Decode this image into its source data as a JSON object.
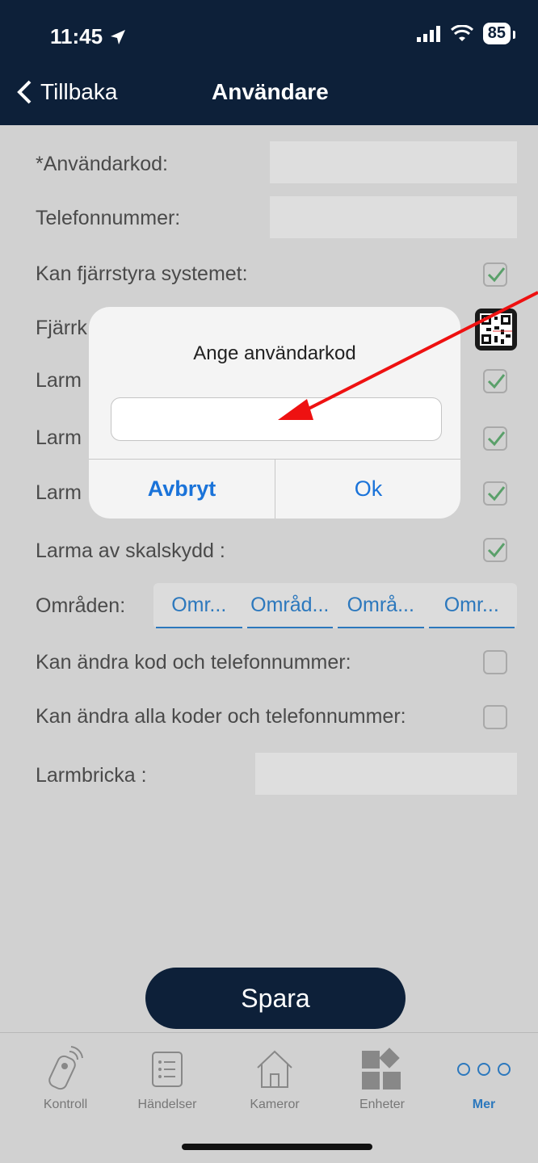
{
  "status_bar": {
    "time": "11:45",
    "battery": "85"
  },
  "nav": {
    "back_label": "Tillbaka",
    "title": "Användare"
  },
  "form": {
    "user_code_label": "*Användarkod:",
    "phone_label": "Telefonnummer:",
    "remote_control_label": "Kan fjärrstyra systemet:",
    "remote_control_checked": true,
    "remote_key_label_partial": "Fjärrk",
    "arm1_label_partial": "Larm",
    "arm1_checked": true,
    "arm2_label_partial": "Larm",
    "arm2_checked": true,
    "arm3_label_partial": "Larm",
    "arm3_checked": true,
    "disarm_shell_label": "Larma av skalskydd :",
    "disarm_shell_checked": true,
    "areas_label": "Områden:",
    "areas": [
      "Omr...",
      "Områd...",
      "Områ...",
      "Omr..."
    ],
    "change_own_label": "Kan ändra kod och telefonnummer:",
    "change_own_checked": false,
    "change_all_label": "Kan ändra alla koder och telefonnummer:",
    "change_all_checked": false,
    "tag_label": "Larmbricka :"
  },
  "save_label": "Spara",
  "dialog": {
    "title": "Ange användarkod",
    "input_value": "",
    "cancel_label": "Avbryt",
    "ok_label": "Ok"
  },
  "tabs": [
    {
      "label": "Kontroll",
      "icon": "remote-control-icon",
      "active": false
    },
    {
      "label": "Händelser",
      "icon": "event-list-icon",
      "active": false
    },
    {
      "label": "Kameror",
      "icon": "house-camera-icon",
      "active": false
    },
    {
      "label": "Enheter",
      "icon": "devices-grid-icon",
      "active": false
    },
    {
      "label": "Mer",
      "icon": "more-dots-icon",
      "active": true
    }
  ],
  "colors": {
    "header": "#0d2039",
    "accent": "#2c78bd",
    "check": "#5aa06a",
    "annotation_arrow": "#ee1111"
  }
}
